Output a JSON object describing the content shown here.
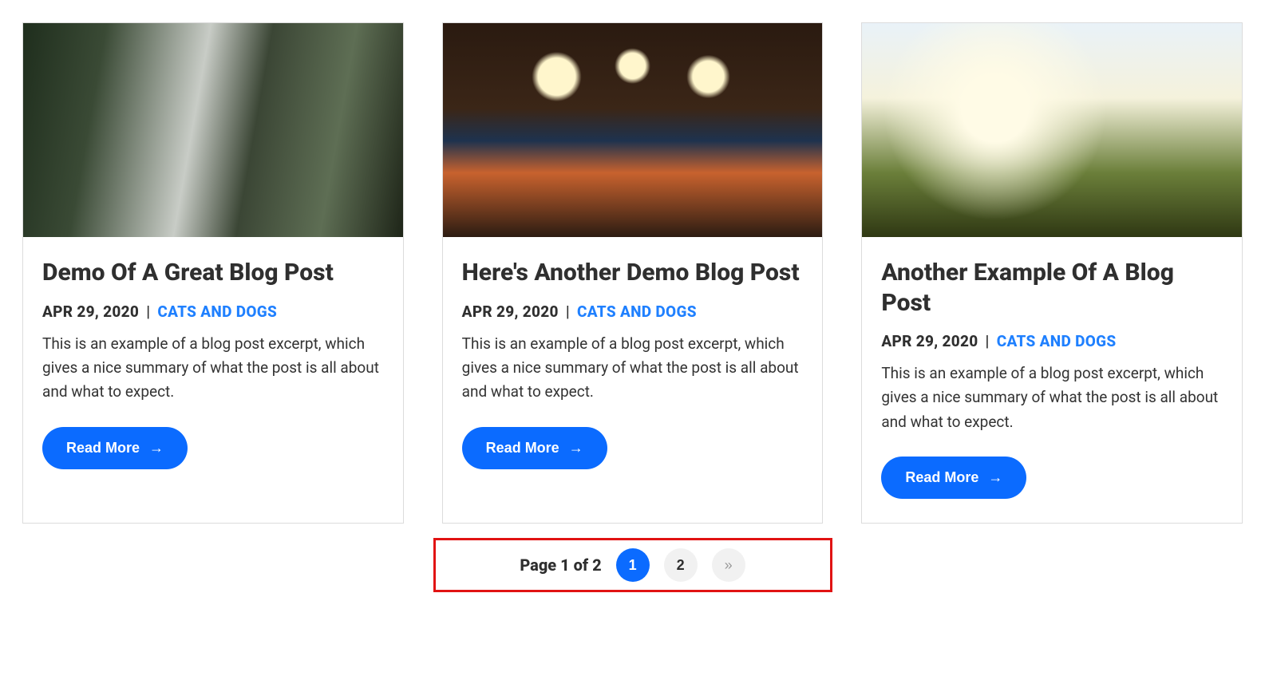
{
  "posts": [
    {
      "title": "Demo Of A Great Blog Post",
      "date": "APR 29, 2020",
      "sep": "|",
      "category": "CATS AND DOGS",
      "excerpt": "This is an example of a blog post excerpt, which gives a nice summary of what the post is all about and what to expect.",
      "button": "Read More",
      "thumb_class": "forest"
    },
    {
      "title": "Here's Another Demo Blog Post",
      "date": "APR 29, 2020",
      "sep": "|",
      "category": "CATS AND DOGS",
      "excerpt": "This is an example of a blog post excerpt, which gives a nice summary of what the post is all about and what to expect.",
      "button": "Read More",
      "thumb_class": "bar"
    },
    {
      "title": "Another Example Of A Blog Post",
      "date": "APR 29, 2020",
      "sep": "|",
      "category": "CATS AND DOGS",
      "excerpt": "This is an example of a blog post excerpt, which gives a nice summary of what the post is all about and what to expect.",
      "button": "Read More",
      "thumb_class": "field"
    }
  ],
  "pagination": {
    "label": "Page 1 of 2",
    "page1": "1",
    "page2": "2",
    "next": "»"
  },
  "icons": {
    "arrow": "→"
  }
}
